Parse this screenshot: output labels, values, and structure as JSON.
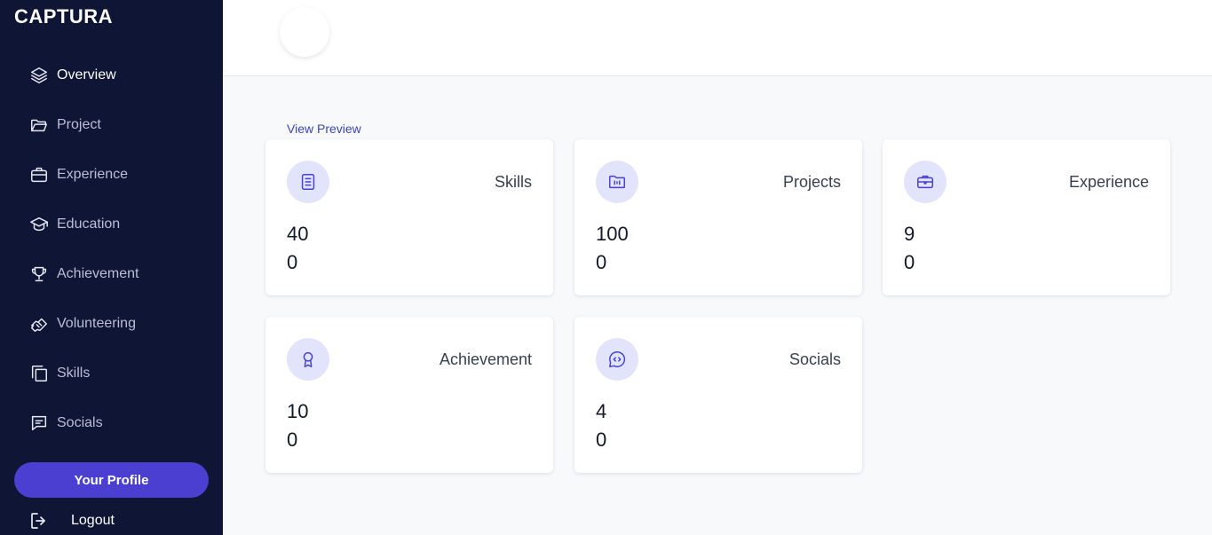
{
  "brand": "CAPTURA",
  "nav": [
    {
      "label": "Overview",
      "icon": "layers-icon",
      "active": true
    },
    {
      "label": "Project",
      "icon": "folder-icon"
    },
    {
      "label": "Experience",
      "icon": "briefcase-icon"
    },
    {
      "label": "Education",
      "icon": "graduation-cap-icon"
    },
    {
      "label": "Achievement",
      "icon": "trophy-icon"
    },
    {
      "label": "Volunteering",
      "icon": "handshake-icon"
    },
    {
      "label": "Skills",
      "icon": "copy-icon"
    },
    {
      "label": "Socials",
      "icon": "chat-icon"
    }
  ],
  "profile_button": "Your Profile",
  "logout_label": "Logout",
  "view_preview": "View Preview",
  "cards": [
    {
      "title": "Skills",
      "count": "40",
      "sub": "0",
      "icon": "book-icon"
    },
    {
      "title": "Projects",
      "count": "100",
      "sub": "0",
      "icon": "folder-code-icon"
    },
    {
      "title": "Experience",
      "count": "9",
      "sub": "0",
      "icon": "briefcase-icon"
    },
    {
      "title": "Achievement",
      "count": "10",
      "sub": "0",
      "icon": "award-icon"
    },
    {
      "title": "Socials",
      "count": "4",
      "sub": "0",
      "icon": "chat-code-icon"
    }
  ],
  "colors": {
    "sidebar_bg": "#0f1534",
    "accent": "#4a3fd1",
    "badge_bg": "#e1e4fb"
  }
}
